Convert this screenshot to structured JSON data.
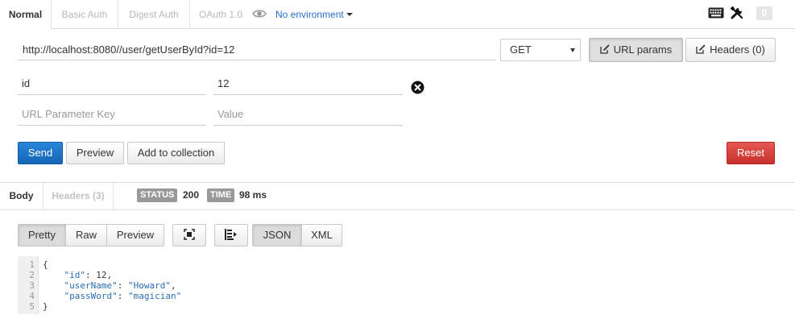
{
  "auth_tabs": [
    "Normal",
    "Basic Auth",
    "Digest Auth",
    "OAuth 1.0"
  ],
  "environment": {
    "label": "No environment"
  },
  "top_right": {
    "count": "0"
  },
  "request": {
    "url": "http://localhost:8080//user/getUserById?id=12",
    "method": "GET",
    "url_params_label": "URL params",
    "headers_label": "Headers (0)"
  },
  "params": {
    "rows": [
      {
        "key": "id",
        "value": "12"
      }
    ],
    "key_placeholder": "URL Parameter Key",
    "value_placeholder": "Value"
  },
  "actions": {
    "send": "Send",
    "preview": "Preview",
    "add_to_collection": "Add to collection",
    "reset": "Reset"
  },
  "response": {
    "tabs": [
      "Body",
      "Headers (3)"
    ],
    "status_label": "STATUS",
    "status_value": "200",
    "time_label": "TIME",
    "time_value": "98 ms",
    "view_modes": [
      "Pretty",
      "Raw",
      "Preview"
    ],
    "formats": [
      "JSON",
      "XML"
    ],
    "line_numbers": [
      "1",
      "2",
      "3",
      "4",
      "5"
    ],
    "body": {
      "open": "{",
      "fields": [
        {
          "key": "\"id\"",
          "value": "12",
          "suffix": ","
        },
        {
          "key": "\"userName\"",
          "value": "\"Howard\"",
          "suffix": ","
        },
        {
          "key": "\"passWord\"",
          "value": "\"magician\"",
          "suffix": ""
        }
      ],
      "close": "}"
    }
  },
  "colors": {
    "accent": "#2a6fc9",
    "send": "#1565b8",
    "reset": "#c9302c",
    "badge": "#999999"
  }
}
